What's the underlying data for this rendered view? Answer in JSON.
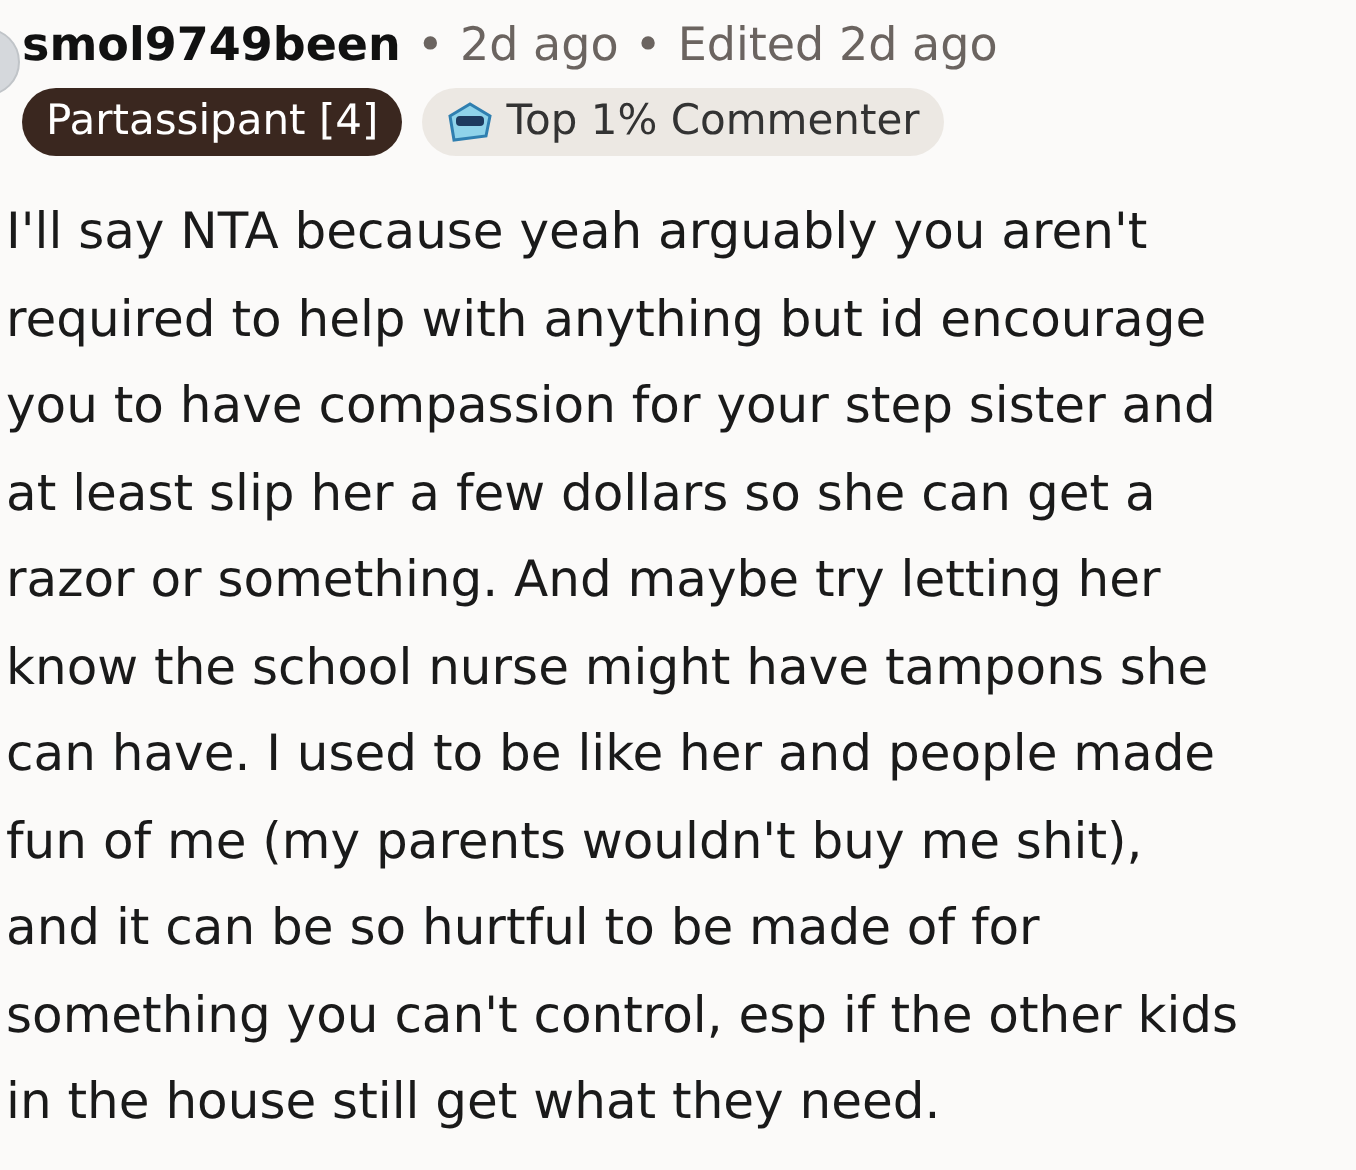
{
  "comment": {
    "author": "smol9749been",
    "meta": [
      "2d ago",
      "Edited 2d ago"
    ],
    "separator": "•",
    "flairs": [
      {
        "kind": "user",
        "label": "Partassipant [4]"
      },
      {
        "kind": "achievement",
        "label": "Top 1% Commenter"
      }
    ],
    "body_lines": [
      "I'll say NTA because yeah arguably you aren't",
      "required to help with anything but id encourage",
      "you to have compassion for your step sister and",
      "at least slip her a few dollars so she can get a",
      "razor or something. And maybe try letting her",
      "know the school nurse might have tampons she",
      "can have. I used to be like her and people made",
      "fun of me (my parents wouldn't buy me shit),",
      "and it can be so hurtful to be made of for",
      "something you can't control, esp if the other kids",
      "in the house still get what they need."
    ]
  }
}
